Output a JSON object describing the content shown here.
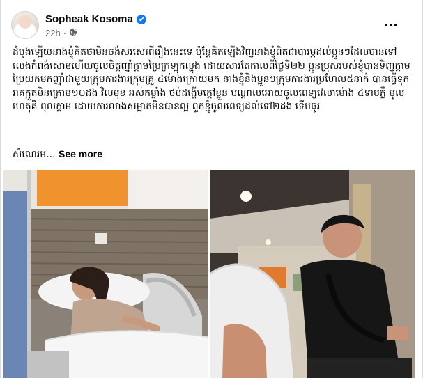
{
  "post": {
    "author": "Sopheak Kosoma",
    "time": "22h",
    "body": "ដំបូងឡើយនាងខ្ញុំគិតថាមិនចង់សរសេរពីរឿងនេះទេ ប៉ុន្តែគិតឡើងវិញនាងខ្ញុំពិតជាបារម្ភដល់ប្អូនៗដែលបានទៅលេងកំពង់សោមហើយចូលចិត្តញ៉ាំក្តាមប្រៃក្រឡុកល្ហុង ដោយសារតែកាលពីថ្ងៃទី២២ ប្អូនប្រុសរបស់ខ្ញុំបានទិញក្តាមប្រៃយកមកញ៉ាំជាមួយក្រុមការងារក្រុមគ្រួ ៤ម៉ោងក្រោយមក នាងខ្ញុំនិងប្អូនៗក្រុមការងារប្រហែល៥នាក់ បានធ្វើទុក រាគក្អួតមិនក្រោម១០ដង វិលមុខ អស់កម្លាំង ថប់ដង្ហើមក្តៅខ្លួន បណ្តាលអោយចូលពេទ្យវេលាម៉ោង ៤ទាបភ្លឺ មូលហេតុគឺ ពុលក្តាម ដោយការលាងសម្អាតមិនបានល្អ ពួកខ្ញុំចូលពេទ្យដល់ទៅ២ដង ទើបធូរ",
    "truncated_line": "សំណេរម...",
    "see_more_label": "See more"
  },
  "icons": {
    "verified": "verified-badge-icon",
    "privacy": "globe-icon",
    "more": "more-options-icon"
  },
  "colors": {
    "verified_blue": "#1877f2",
    "secondary_text": "#65676b"
  }
}
